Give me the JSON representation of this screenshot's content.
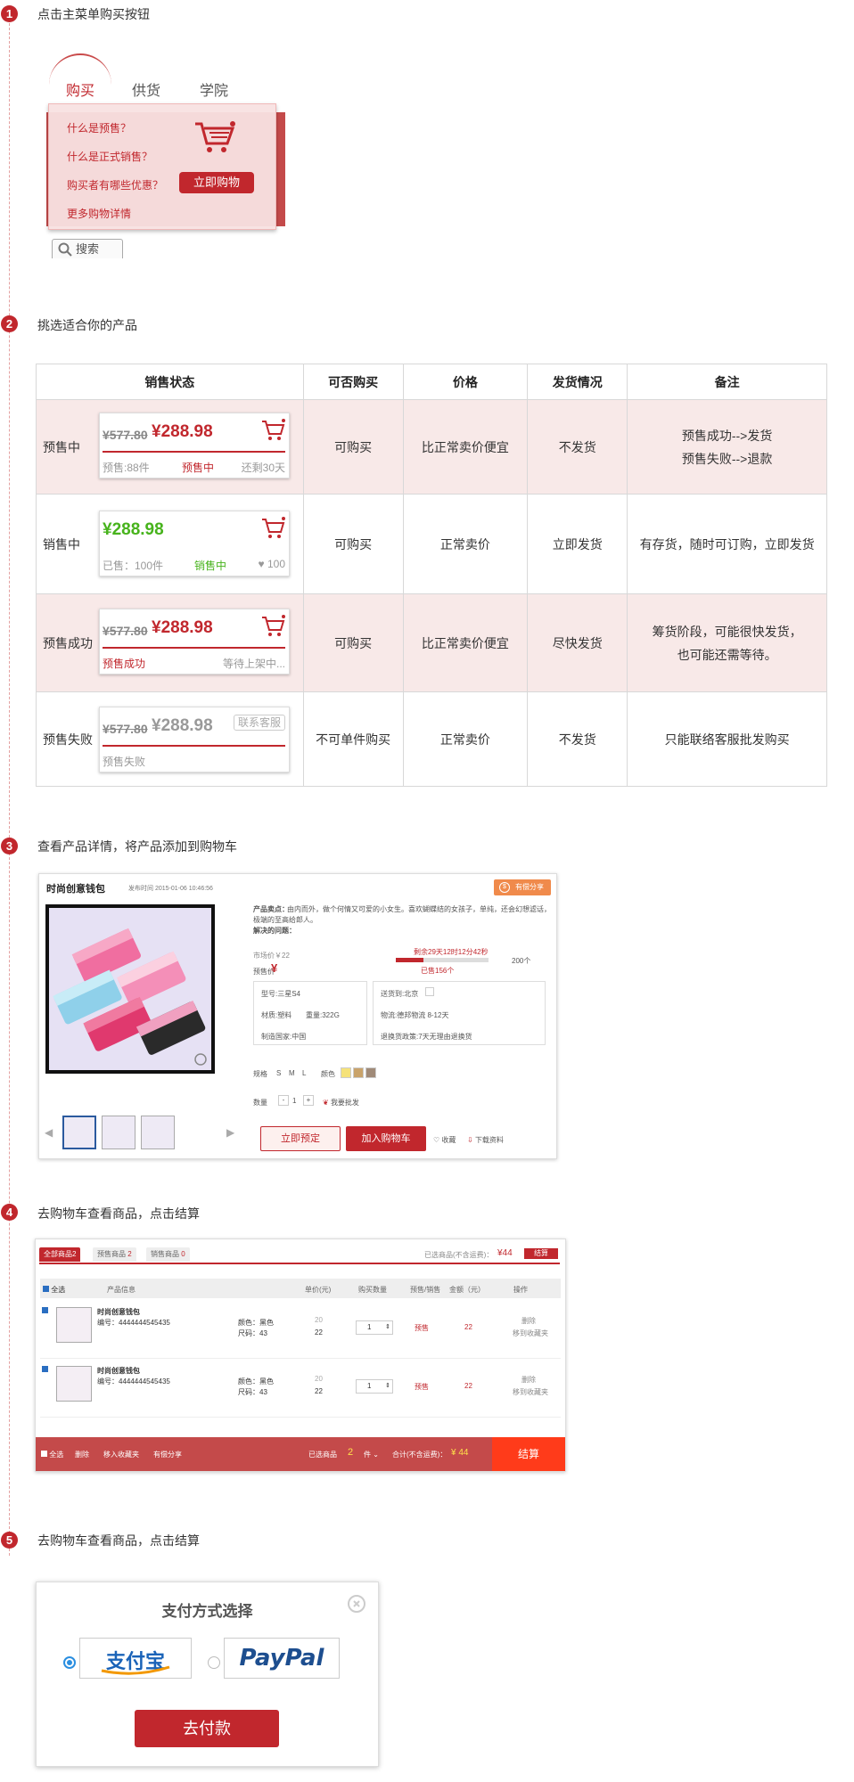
{
  "steps": [
    {
      "num": "1",
      "title": "点击主菜单购买按钮"
    },
    {
      "num": "2",
      "title": "挑选适合你的产品"
    },
    {
      "num": "3",
      "title": "查看产品详情，将产品添加到购物车"
    },
    {
      "num": "4",
      "title": "去购物车查看商品，点击结算"
    },
    {
      "num": "5",
      "title": "去购物车查看商品，点击结算"
    }
  ],
  "menu": {
    "nav": [
      "购买",
      "供货",
      "学院"
    ],
    "items": [
      "什么是预售？",
      "什么是正式销售？",
      "购买者有哪些优惠？",
      "更多购物详情"
    ],
    "buy_button": "立即购物",
    "search": "搜索"
  },
  "table": {
    "headers": [
      "销售状态",
      "可否购买",
      "价格",
      "发货情况",
      "备注"
    ],
    "rows": [
      {
        "state": "预售中",
        "old_price": "¥577.80",
        "price": "¥288.98",
        "left": "预售:88件",
        "mid": "预售中",
        "right": "还剩30天",
        "can_buy": "可购买",
        "price_desc": "比正常卖价便宜",
        "ship": "不发货",
        "note1": "预售成功-->发货",
        "note2": "预售失败-->退款"
      },
      {
        "state": "销售中",
        "old_price": "",
        "price": "¥288.98",
        "left": "已售：100件",
        "mid": "销售中",
        "right": "100",
        "can_buy": "可购买",
        "price_desc": "正常卖价",
        "ship": "立即发货",
        "note1": "有存货，随时可订购，立即发货",
        "note2": ""
      },
      {
        "state": "预售成功",
        "old_price": "¥577.80",
        "price": "¥288.98",
        "left": "预售成功",
        "mid": "",
        "right": "等待上架中...",
        "can_buy": "可购买",
        "price_desc": "比正常卖价便宜",
        "ship": "尽快发货",
        "note1": "筹货阶段，可能很快发货，",
        "note2": "也可能还需等待。"
      },
      {
        "state": "预售失败",
        "old_price": "¥577.80",
        "price": "¥288.98",
        "left": "预售失败",
        "mid": "",
        "right": "联系客服",
        "can_buy": "不可单件购买",
        "price_desc": "正常卖价",
        "ship": "不发货",
        "note1": "只能联络客服批发购买",
        "note2": ""
      }
    ]
  },
  "product": {
    "name": "时尚创意钱包",
    "publish": "发布时间 2015-01-06 10:46:56",
    "share": "有偿分享",
    "highlight_label": "产品卖点：",
    "highlight": "由内而外，做个何情又可爱的小女生。喜欢蝴蝶结的女孩子，单纯，还会幻想滤话，将优雅",
    "highlight2": "极端的至高给郎人。",
    "problem_label": "解决的问题：",
    "market_price": "市场价￥22",
    "presale_price_label": "预售价",
    "presale_price": "¥",
    "countdown": "剩余29天12时12分42秒",
    "sold": "已售156个",
    "target": "200个",
    "specs": [
      "型号:三星S4",
      "材质:塑料",
      "重量:322G",
      "制造国家:中国"
    ],
    "ship_info": [
      "送货到:北京",
      "物流:德邦物流 8-12天",
      "退换货政策:7天无理由退换货"
    ],
    "size_label": "规格",
    "sizes": [
      "S",
      "M",
      "L"
    ],
    "color_label": "颜色",
    "colors": [
      "#f5e27a",
      "#c9a36b",
      "#a08a78"
    ],
    "qty_label": "数量",
    "qty": "1",
    "wholesale": "我要批发",
    "btn_preorder": "立即预定",
    "btn_cart": "加入购物车",
    "favorite": "收藏",
    "download": "下载资料"
  },
  "cart": {
    "tabs": [
      "全部商品",
      "2",
      "预售商品",
      "2",
      "销售商品",
      "0"
    ],
    "selected_label": "已选商品(不含运费)：",
    "selected_price": "¥44",
    "settle_small": "结算",
    "headers": [
      "全选",
      "产品信息",
      "单价(元)",
      "购买数量",
      "预售/销售",
      "金额（元）",
      "操作"
    ],
    "rows": [
      {
        "name": "时尚创意钱包",
        "code": "编号：4444444545435",
        "color": "颜色：黑色",
        "size": "尺码：43",
        "price_old": "20",
        "price": "22",
        "qty": "1",
        "type": "预售",
        "amount": "22",
        "op1": "删除",
        "op2": "移到收藏夹"
      },
      {
        "name": "时尚创意钱包",
        "code": "编号：4444444545435",
        "color": "颜色：黑色",
        "size": "尺码：43",
        "price_old": "20",
        "price": "22",
        "qty": "1",
        "type": "预售",
        "amount": "22",
        "op1": "删除",
        "op2": "移到收藏夹"
      }
    ],
    "bottom": {
      "select_all": "全选",
      "delete": "删除",
      "move": "移入收藏夹",
      "share": "有偿分享",
      "selected": "已选商品",
      "count": "2",
      "unit": "件",
      "total_label": "合计(不含运费)：",
      "total": "¥ 44",
      "settle": "结算"
    }
  },
  "payment": {
    "title": "支付方式选择",
    "alipay": "支付宝",
    "paypal": "PayPal",
    "pay_button": "去付款"
  }
}
